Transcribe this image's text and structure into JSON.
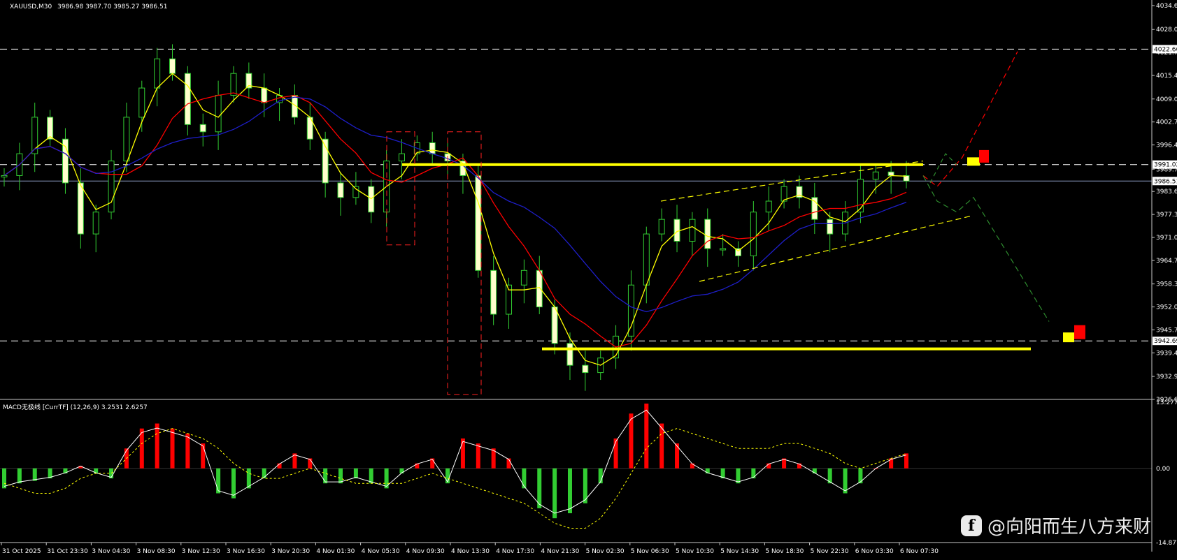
{
  "header": {
    "symbol": "XAUUSD,M30",
    "ohlc": "3986.98 3987.70 3985.27 3986.51"
  },
  "macd_panel": {
    "label": "MACD无极线 [CurrTF] (12,26,9) 3.2531 2.6257",
    "ticks": [
      "13.2772",
      "0.00",
      "-14.8772"
    ]
  },
  "colors": {
    "background": "#000000",
    "candle_bull": "#32cd32",
    "candle_bear_body": "#ffffcc",
    "ma_fast": "#ffff00",
    "ma_mid": "#ff0000",
    "ma_slow": "#1e1ec8",
    "level_line": "#ffffff",
    "highlight": "#ffff00",
    "bear_projection": "#ff0000",
    "alt_projection": "#2e8b2e",
    "macd_pos": "#ff0000",
    "macd_neg": "#32cd32"
  },
  "watermark": {
    "text": "@向阳而生八方来财",
    "icon": "facebook-icon"
  },
  "chart_data": {
    "type": "candlestick",
    "symbol": "XAUUSD",
    "timeframe": "M30",
    "ylim": [
      3926.65,
      4034.6
    ],
    "price_ticks": [
      "4034.60",
      "4028.05",
      "4021.75",
      "4015.45",
      "4009.00",
      "4002.70",
      "3996.40",
      "3989.75",
      "3983.65",
      "3977.35",
      "3971.05",
      "3964.75",
      "3958.30",
      "3952.00",
      "3945.70",
      "3939.40",
      "3932.95",
      "3926.65"
    ],
    "price_tags": [
      "4022.66",
      "3991.02",
      "3986.51",
      "3942.69"
    ],
    "time_labels": [
      "31 Oct 2025",
      "31 Oct 23:30",
      "3 Nov 04:30",
      "3 Nov 08:30",
      "3 Nov 12:30",
      "3 Nov 16:30",
      "3 Nov 20:30",
      "4 Nov 01:30",
      "4 Nov 05:30",
      "4 Nov 09:30",
      "4 Nov 13:30",
      "4 Nov 17:30",
      "4 Nov 21:30",
      "5 Nov 02:30",
      "5 Nov 06:30",
      "5 Nov 10:30",
      "5 Nov 14:30",
      "5 Nov 18:30",
      "5 Nov 22:30",
      "6 Nov 03:30",
      "6 Nov 07:30"
    ],
    "close_path": [
      3988,
      3994,
      4004,
      3998,
      3986,
      3972,
      3978,
      3992,
      4004,
      4012,
      4020,
      4016,
      4002,
      4000,
      4010,
      4016,
      4012,
      4008,
      4010,
      4004,
      3998,
      3986,
      3982,
      3985,
      3978,
      3992,
      3994,
      3997,
      3994,
      3992,
      3988,
      3962,
      3950,
      3958,
      3962,
      3952,
      3942,
      3936,
      3934,
      3938,
      3944,
      3958,
      3972,
      3976,
      3970,
      3976,
      3968,
      3968,
      3966,
      3978,
      3981,
      3985,
      3982,
      3976,
      3972,
      3978,
      3987,
      3989,
      3988,
      3986.5
    ],
    "horizontal_levels": [
      4022.66,
      3991.02,
      3986.51,
      3942.69
    ],
    "highlight_levels": [
      3991.02,
      3940.5
    ],
    "macd_range": [
      -14.8772,
      13.2772
    ],
    "macd_hist": [
      -4,
      -3,
      -2.5,
      -2,
      -1,
      0.5,
      -1,
      -2,
      4,
      8,
      9,
      8,
      7,
      5,
      -5,
      -6,
      -4,
      -2,
      1,
      3,
      2,
      -3,
      -3,
      -2,
      -3,
      -4,
      -1,
      1,
      2,
      -3,
      6,
      5,
      4,
      2,
      -4,
      -8,
      -10,
      -9,
      -7,
      -3,
      6,
      11,
      13,
      9,
      5,
      1,
      -1,
      -2,
      -3,
      -2,
      1,
      2,
      1,
      -1,
      -3,
      -5,
      -3,
      0,
      2,
      3
    ],
    "macd_signal": [
      -3,
      -4,
      -5,
      -5,
      -4,
      -2,
      -1,
      -1,
      2,
      5,
      7,
      8,
      7,
      6,
      4,
      1,
      -1,
      -2,
      -2,
      -1,
      0,
      -1,
      -2,
      -3,
      -3,
      -3,
      -3,
      -2,
      -1,
      -2,
      -3,
      -4,
      -5,
      -6,
      -7,
      -9,
      -11,
      -12,
      -12,
      -10,
      -6,
      -1,
      4,
      7,
      8,
      7,
      6,
      5,
      4,
      4,
      4,
      5,
      5,
      4,
      3,
      1,
      0,
      1,
      2,
      3
    ]
  }
}
